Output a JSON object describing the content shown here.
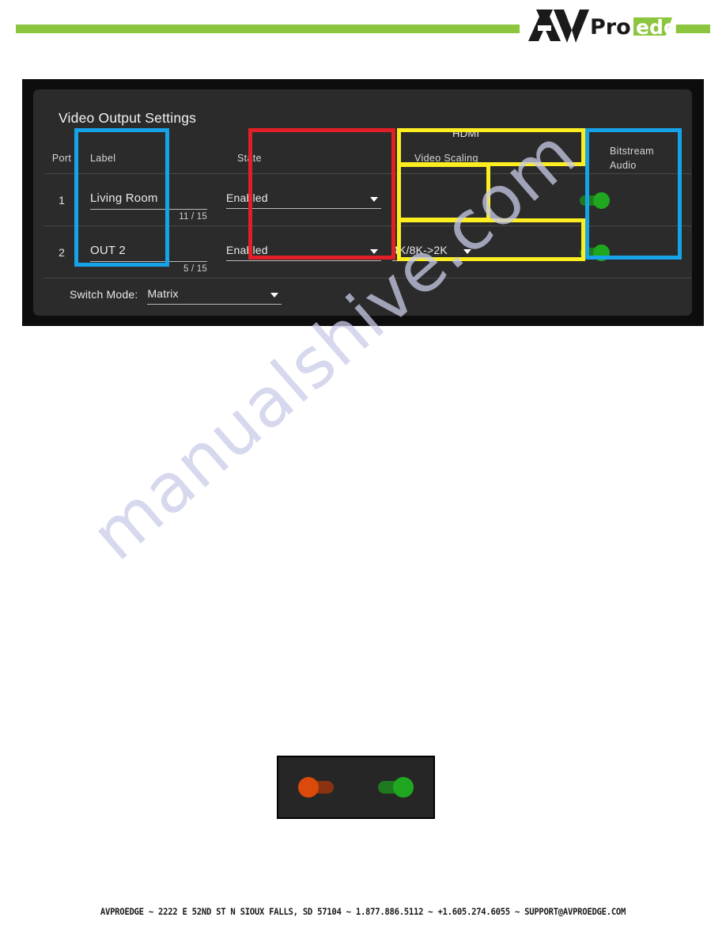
{
  "header": {
    "logo_av": "AV",
    "logo_pro": "Pro",
    "logo_edge": "edge",
    "accent_green": "#8CC63E"
  },
  "panel": {
    "title": "Video Output Settings",
    "group_caption": "HDMI",
    "columns": {
      "port": "Port",
      "label": "Label",
      "state": "State",
      "video_scaling": "Video Scaling",
      "bitstream": "Bitstream",
      "audio": "Audio"
    },
    "rows": [
      {
        "port": "1",
        "label_value": "Living Room",
        "label_counter": "11 / 15",
        "state_value": "Enabled",
        "scaling_value": "",
        "bitstream_audio": "on"
      },
      {
        "port": "2",
        "label_value": "OUT 2",
        "label_counter": "5 / 15",
        "state_value": "Enabled",
        "scaling_value": "4K/8K->2K",
        "bitstream_audio": "on"
      }
    ],
    "switch_mode": {
      "label": "Switch Mode:",
      "value": "Matrix"
    }
  },
  "annotations": {
    "blue_color": "#17A3E8",
    "red_color": "#E01F26",
    "yellow_color": "#FCEE21"
  },
  "legend": {
    "off_state": "off",
    "on_state": "on",
    "off_color": "#DB4A0B",
    "on_color": "#1FA81F"
  },
  "watermark": {
    "text": "manualshive.com"
  },
  "footer": {
    "text": "AVPROEDGE  ~  2222 E 52ND ST N SIOUX FALLS, SD 57104  ~  1.877.886.5112  ~  +1.605.274.6055  ~  SUPPORT@AVPROEDGE.COM"
  }
}
